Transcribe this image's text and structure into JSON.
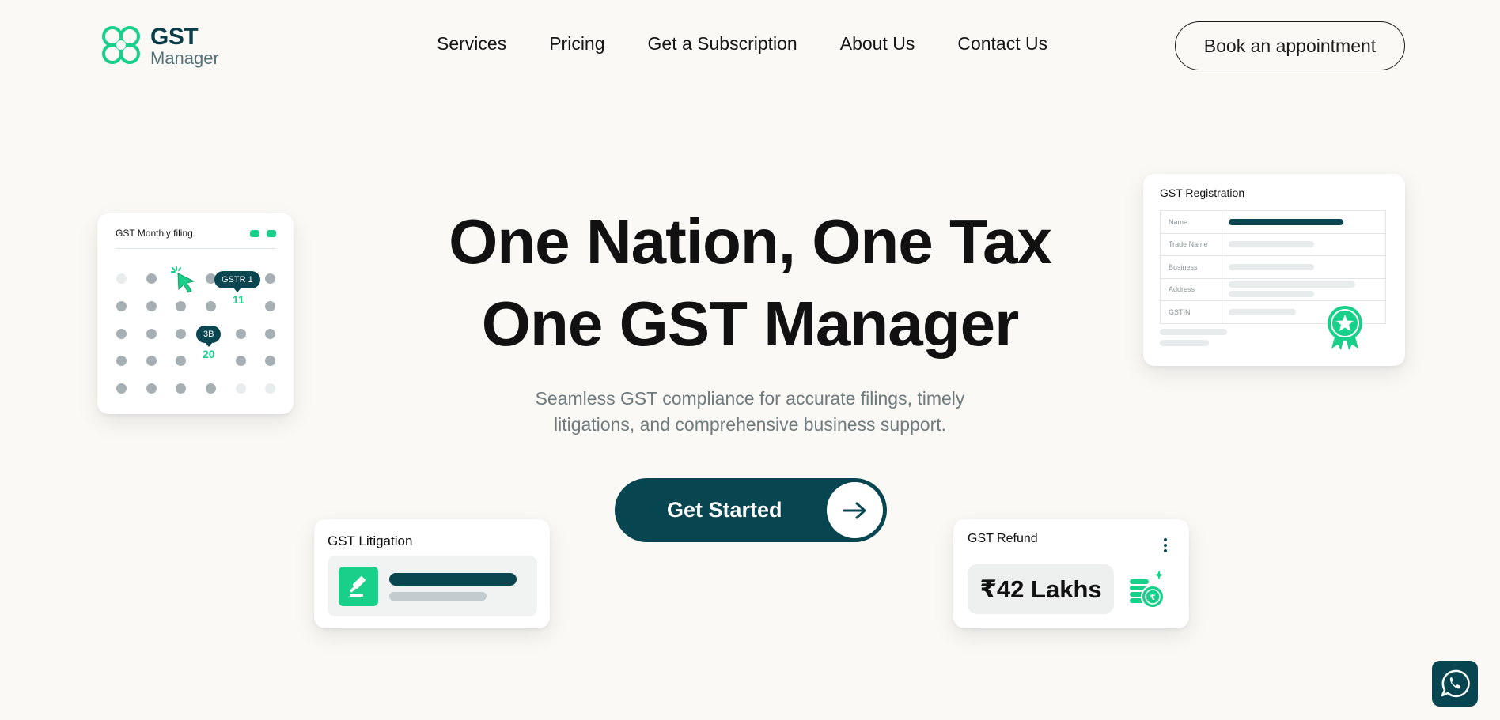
{
  "brand": {
    "title": "GST",
    "subtitle": "Manager",
    "accent": "#18d08a",
    "primary": "#074550"
  },
  "nav": {
    "items": [
      {
        "label": "Services"
      },
      {
        "label": "Pricing"
      },
      {
        "label": "Get a Subscription"
      },
      {
        "label": "About Us"
      },
      {
        "label": "Contact Us"
      }
    ],
    "cta_label": "Book an appointment"
  },
  "hero": {
    "title_line1": "One Nation, One Tax",
    "title_line2": "One GST Manager",
    "subtitle_line1": "Seamless GST compliance for accurate filings, timely",
    "subtitle_line2": "litigations, and comprehensive business support.",
    "cta_label": "Get Started",
    "cta_icon": "arrow-right-icon"
  },
  "cards": {
    "monthly_filing": {
      "title": "GST Monthly filing",
      "tooltip_1": "GSTR 1",
      "date_1": "11",
      "tooltip_2": "3B",
      "date_2": "20"
    },
    "registration": {
      "title": "GST Registration",
      "rows": [
        {
          "label": "Name"
        },
        {
          "label": "Trade Name"
        },
        {
          "label": "Business"
        },
        {
          "label": "Address"
        },
        {
          "label": "GSTIN"
        }
      ],
      "badge_icon": "award-ribbon-icon"
    },
    "litigation": {
      "title": "GST Litigation",
      "icon": "gavel-icon"
    },
    "refund": {
      "title": "GST Refund",
      "amount": "₹42 Lakhs",
      "icon": "coins-icon"
    }
  },
  "whatsapp": {
    "icon": "whatsapp-icon"
  }
}
